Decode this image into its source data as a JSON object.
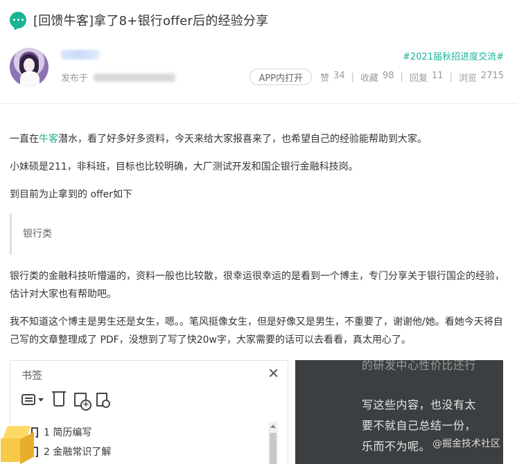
{
  "post": {
    "title": "[回馈牛客]拿了8+银行offer后的经验分享",
    "publish_label": "发布于",
    "topic_tag": "#2021届秋招进度交流#"
  },
  "stats": {
    "app_button": "APP内打开",
    "likes_label": "赞",
    "likes": "34",
    "favorites_label": "收藏",
    "favorites": "98",
    "replies_label": "回复",
    "replies": "11",
    "views_label": "浏览",
    "views": "2715",
    "separator": "|"
  },
  "content": {
    "p1_before": "一直在",
    "p1_link": "牛客",
    "p1_after": "潜水，看了好多好多资料，今天来给大家报喜来了，也希望自己的经验能帮助到大家。",
    "p2": "小妹硕是211，非科班，目标也比较明确，大厂测试开发和国企银行金融科技岗。",
    "p3": "到目前为止拿到的 offer如下",
    "quote": "银行类",
    "p4": "银行类的金融科技听懵逼的，资料一般也比较散，很幸运很幸运的是看到一个博主，专门分享关于银行国企的经验，估计对大家也有帮助吧。",
    "p5": "我不知道这个博主是男生还是女生，嗯。。笔风挺像女生，但是好像又是男生，不重要了，谢谢他/她。看她今天将自己写的文章整理成了 PDF，没想到了写了快20w字，大家需要的话可以去看看，真太用心了。"
  },
  "embed": {
    "bookmarks_title": "书签",
    "close_symbol": "✕",
    "bookmarks": [
      {
        "label": "1 简历编写"
      },
      {
        "label": "2 金融常识了解"
      }
    ],
    "doc_lines": [
      "的研发中心性价比还行",
      "写这些内容，也没有太",
      "要不就自己总结一份，",
      "乐而不为呢。"
    ],
    "watermark": "@掘金技术社区"
  }
}
